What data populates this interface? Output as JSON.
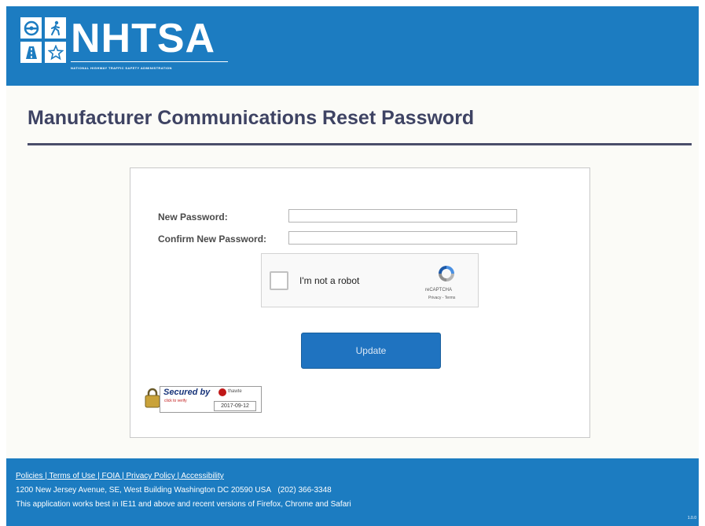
{
  "header": {
    "logo_text": "NHTSA",
    "logo_subtitle": "NATIONAL HIGHWAY TRAFFIC SAFETY ADMINISTRATION",
    "logo_icons": [
      "steering-wheel-icon",
      "pedestrian-icon",
      "road-icon",
      "star-icon"
    ],
    "brand_color": "#1c7cc1"
  },
  "page_title": "Manufacturer Communications Reset Password",
  "form": {
    "new_password_label": "New Password:",
    "new_password_value": "",
    "confirm_password_label": "Confirm New Password:",
    "confirm_password_value": "",
    "captcha": {
      "label": "I'm not a robot",
      "brand": "reCAPTCHA",
      "links": "Privacy - Terms"
    },
    "submit_label": "Update"
  },
  "seal": {
    "title": "Secured by",
    "brand": "thawte",
    "subtitle": "click to verify",
    "date": "2017-09-12"
  },
  "footer": {
    "links": [
      "Policies",
      "Terms of Use",
      "FOIA",
      "Privacy Policy",
      "Accessibility"
    ],
    "separator": " | ",
    "address": "1200 New Jersey Avenue, SE, West Building Washington DC 20590 USA",
    "phone": "(202) 366-3348",
    "browser_note": "This application works best in IE11 and above and recent versions of Firefox, Chrome and Safari",
    "version": "1.0.0"
  }
}
